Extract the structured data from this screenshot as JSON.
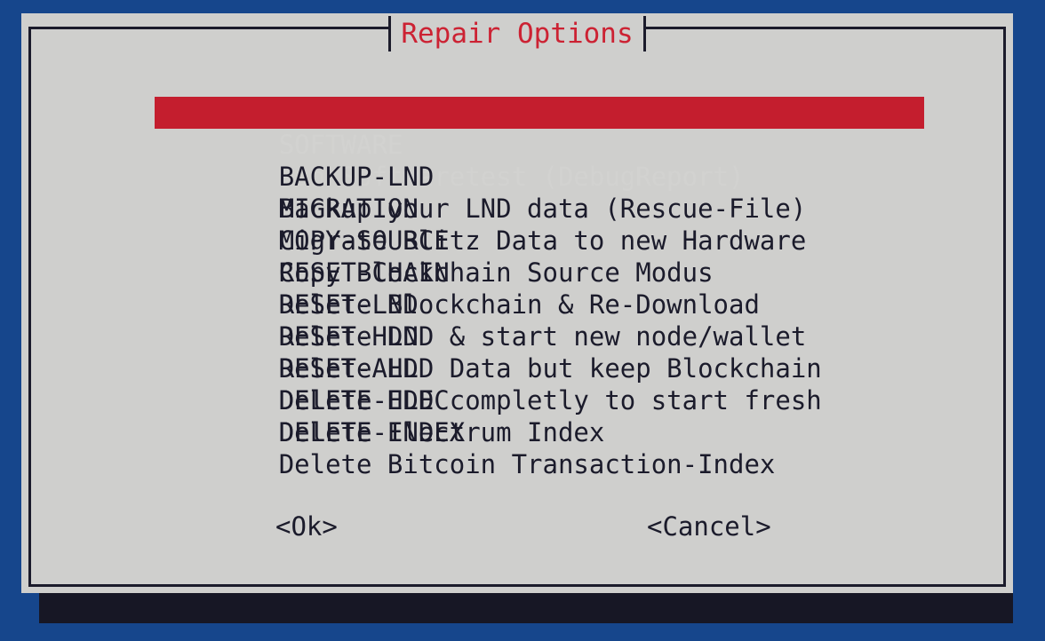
{
  "dialog": {
    "title": "Repair Options",
    "title_color": "#cc2233",
    "background_color": "#cfcfcd",
    "border_color": "#1b1b2b",
    "shadow_color": "#171725",
    "screen_background_color": "#16468c",
    "selection_background_color": "#c41e2e",
    "selection_text_color": "#d2d2d0",
    "text_color": "#1b1b2b"
  },
  "menu": {
    "selected_index": 0,
    "items": [
      {
        "tag": "SOFTWARE    ",
        "description": "Run Softwaretest (DebugReport)"
      },
      {
        "tag": "BACKUP-LND  ",
        "description": "Backup your LND data (Rescue-File)"
      },
      {
        "tag": "MIGRATION   ",
        "description": "Migrate Blitz Data to new Hardware"
      },
      {
        "tag": "COPY-SOURCE ",
        "description": "Copy Blockchain Source Modus"
      },
      {
        "tag": "RESET-CHAIN ",
        "description": "Delete Blockchain & Re-Download"
      },
      {
        "tag": "RESET-LND   ",
        "description": "Delete LND & start new node/wallet"
      },
      {
        "tag": "RESET-HDD   ",
        "description": "Delete HDD Data but keep Blockchain"
      },
      {
        "tag": "RESET-ALL   ",
        "description": "Delete HDD completly to start fresh"
      },
      {
        "tag": "DELETE-ELEC ",
        "description": "Delete Electrum Index"
      },
      {
        "tag": "DELETE-INDEX",
        "description": "Delete Bitcoin Transaction-Index"
      }
    ]
  },
  "buttons": {
    "ok_label": "<Ok>",
    "cancel_label": "<Cancel>"
  }
}
